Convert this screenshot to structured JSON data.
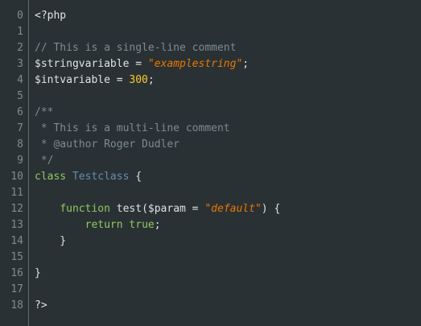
{
  "editor": {
    "lines": [
      {
        "num": "0",
        "tokens": [
          {
            "text": "<?php",
            "cls": "plain"
          }
        ]
      },
      {
        "num": "1",
        "tokens": []
      },
      {
        "num": "2",
        "tokens": [
          {
            "text": "// This is a single-line comment",
            "cls": "comment"
          }
        ]
      },
      {
        "num": "3",
        "tokens": [
          {
            "text": "$stringvariable = ",
            "cls": "var"
          },
          {
            "text": "\"examplestring\"",
            "cls": "string"
          },
          {
            "text": ";",
            "cls": "plain"
          }
        ]
      },
      {
        "num": "4",
        "tokens": [
          {
            "text": "$intvariable = ",
            "cls": "var"
          },
          {
            "text": "300",
            "cls": "number"
          },
          {
            "text": ";",
            "cls": "plain"
          }
        ]
      },
      {
        "num": "5",
        "tokens": []
      },
      {
        "num": "6",
        "tokens": [
          {
            "text": "/**",
            "cls": "comment"
          }
        ]
      },
      {
        "num": "7",
        "tokens": [
          {
            "text": " * This is a multi-line comment",
            "cls": "comment"
          }
        ]
      },
      {
        "num": "8",
        "tokens": [
          {
            "text": " * @author Roger Dudler",
            "cls": "comment"
          }
        ]
      },
      {
        "num": "9",
        "tokens": [
          {
            "text": " */",
            "cls": "comment"
          }
        ]
      },
      {
        "num": "10",
        "tokens": [
          {
            "text": "class ",
            "cls": "keyword"
          },
          {
            "text": "Testclass",
            "cls": "class"
          },
          {
            "text": " {",
            "cls": "plain"
          }
        ]
      },
      {
        "num": "11",
        "tokens": []
      },
      {
        "num": "12",
        "tokens": [
          {
            "text": "    ",
            "cls": "plain"
          },
          {
            "text": "function",
            "cls": "keyword"
          },
          {
            "text": " test($param = ",
            "cls": "plain"
          },
          {
            "text": "\"default\"",
            "cls": "string"
          },
          {
            "text": ") {",
            "cls": "plain"
          }
        ]
      },
      {
        "num": "13",
        "tokens": [
          {
            "text": "        ",
            "cls": "plain"
          },
          {
            "text": "return true",
            "cls": "keyword"
          },
          {
            "text": ";",
            "cls": "plain"
          }
        ]
      },
      {
        "num": "14",
        "tokens": [
          {
            "text": "    }",
            "cls": "plain"
          }
        ]
      },
      {
        "num": "15",
        "tokens": []
      },
      {
        "num": "16",
        "tokens": [
          {
            "text": "}",
            "cls": "plain"
          }
        ]
      },
      {
        "num": "17",
        "tokens": []
      },
      {
        "num": "18",
        "tokens": [
          {
            "text": "?>",
            "cls": "plain"
          }
        ]
      }
    ]
  },
  "colors": {
    "background": "#293134",
    "comment": "#7d8c93",
    "string": "#ec7600",
    "number": "#ffcd22",
    "keyword": "#93c763",
    "class": "#678cb1",
    "plain": "#e0e2e4",
    "line_number": "#7f8c8d"
  }
}
